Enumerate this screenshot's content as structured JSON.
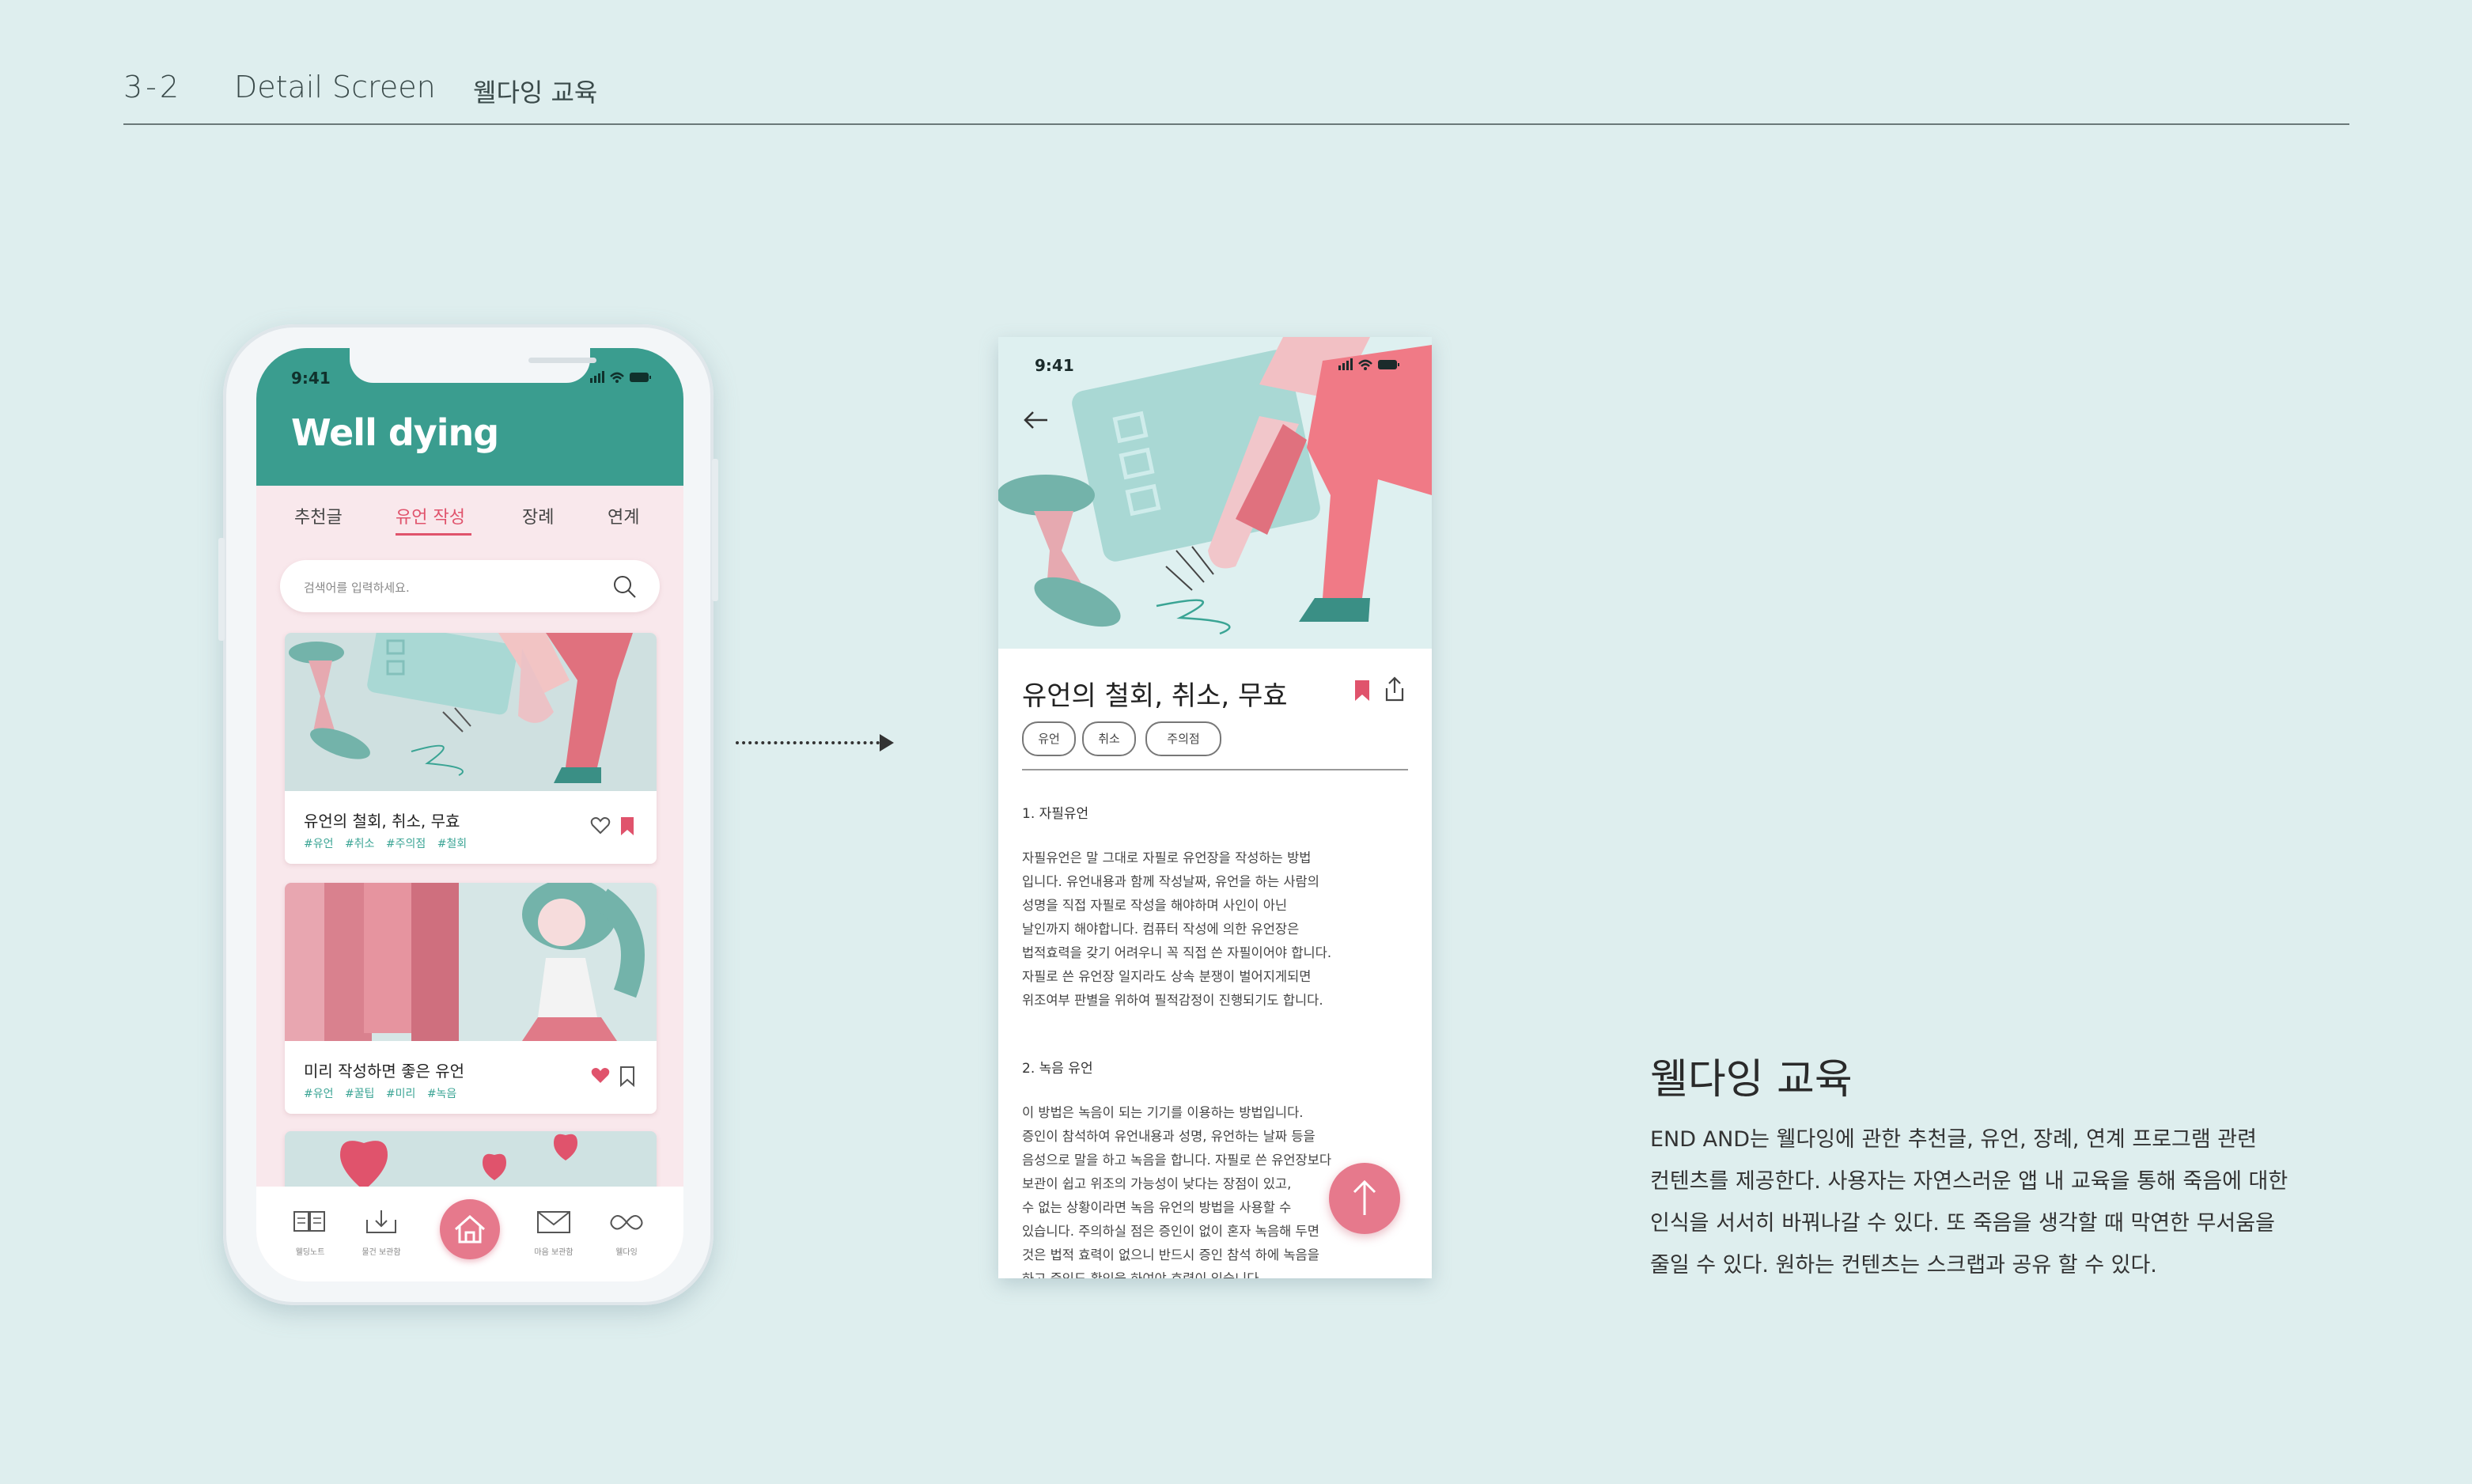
{
  "header": {
    "section_code": "3-2",
    "section_title": "Detail Screen",
    "section_subtitle": "웰다잉 교육"
  },
  "list_screen": {
    "status_time": "9:41",
    "app_title": "Well dying",
    "tabs": [
      {
        "label": "추천글",
        "active": false
      },
      {
        "label": "유언 작성",
        "active": true
      },
      {
        "label": "장례",
        "active": false
      },
      {
        "label": "연계",
        "active": false
      }
    ],
    "search_placeholder": "검색어를 입력하세요.",
    "cards": [
      {
        "title": "유언의 철회, 취소, 무효",
        "tags": "#유언 #취소 #주의점 #철회",
        "liked": false,
        "bookmarked": true
      },
      {
        "title": "미리 작성하면 좋은 유언",
        "tags": "#유언 #꿀팁 #미리 #녹음",
        "liked": true,
        "bookmarked": false
      }
    ],
    "tabbar": [
      {
        "label": "웰딩노트",
        "icon": "book-icon"
      },
      {
        "label": "물건 보관함",
        "icon": "tray-icon"
      },
      {
        "label": "",
        "icon": "home-icon"
      },
      {
        "label": "마음 보관함",
        "icon": "letter-icon"
      },
      {
        "label": "웰다잉",
        "icon": "infinity-icon"
      }
    ]
  },
  "detail_screen": {
    "status_time": "9:41",
    "title": "유언의 철회, 취소, 무효",
    "chips": [
      "유언",
      "취소",
      "주의점"
    ],
    "section1_heading": "1. 자필유언",
    "section1_lines": [
      "자필유언은 말 그대로 자필로 유언장을 작성하는 방법",
      "입니다. 유언내용과 함께 작성날짜, 유언을 하는 사람의",
      "성명을 직접 자필로 작성을 해야하며 사인이 아닌",
      "날인까지 해야합니다. 컴퓨터 작성에 의한 유언장은",
      "법적효력을 갖기 어려우니 꼭 직접 쓴 자필이어야 합니다.",
      "자필로 쓴 유언장 일지라도 상속 분쟁이 벌어지게되면",
      "위조여부 판별을 위하여 필적감정이 진행되기도 합니다."
    ],
    "section2_heading": "2. 녹음 유언",
    "section2_lines": [
      "이 방법은 녹음이 되는 기기를 이용하는 방법입니다.",
      "증인이 참석하여 유언내용과 성명, 유언하는 날짜 등을",
      "음성으로 말을 하고 녹음을 합니다. 자필로 쓴 유언장보다",
      "보관이 쉽고 위조의 가능성이 낮다는 장점이 있고,",
      "수 없는 상황이라면 녹음 유언의 방법을 사용할 수",
      "있습니다. 주의하실 점은 증인이 없이 혼자 녹음해 두면",
      "것은 법적 효력이 없으니 반드시 증인 참석 하에 녹음을",
      "하고 증인도 확인을 하여야 효력이 있습니다."
    ]
  },
  "description": {
    "title": "웰다잉 교육",
    "lines": [
      "END AND는 웰다잉에 관한 추천글, 유언, 장례, 연계 프로그램 관련",
      "컨텐츠를 제공한다. 사용자는 자연스러운 앱 내 교육을 통해 죽음에 대한",
      "인식을 서서히 바꿔나갈 수 있다. 또 죽음을 생각할 때 막연한 무서움을",
      "줄일 수 있다. 원하는 컨텐츠는 스크랩과 공유 할 수 있다."
    ]
  },
  "colors": {
    "background": "#deeeee",
    "teal": "#3a9d8f",
    "accent_pink": "#e0536c",
    "tag_teal": "#3aa494"
  }
}
